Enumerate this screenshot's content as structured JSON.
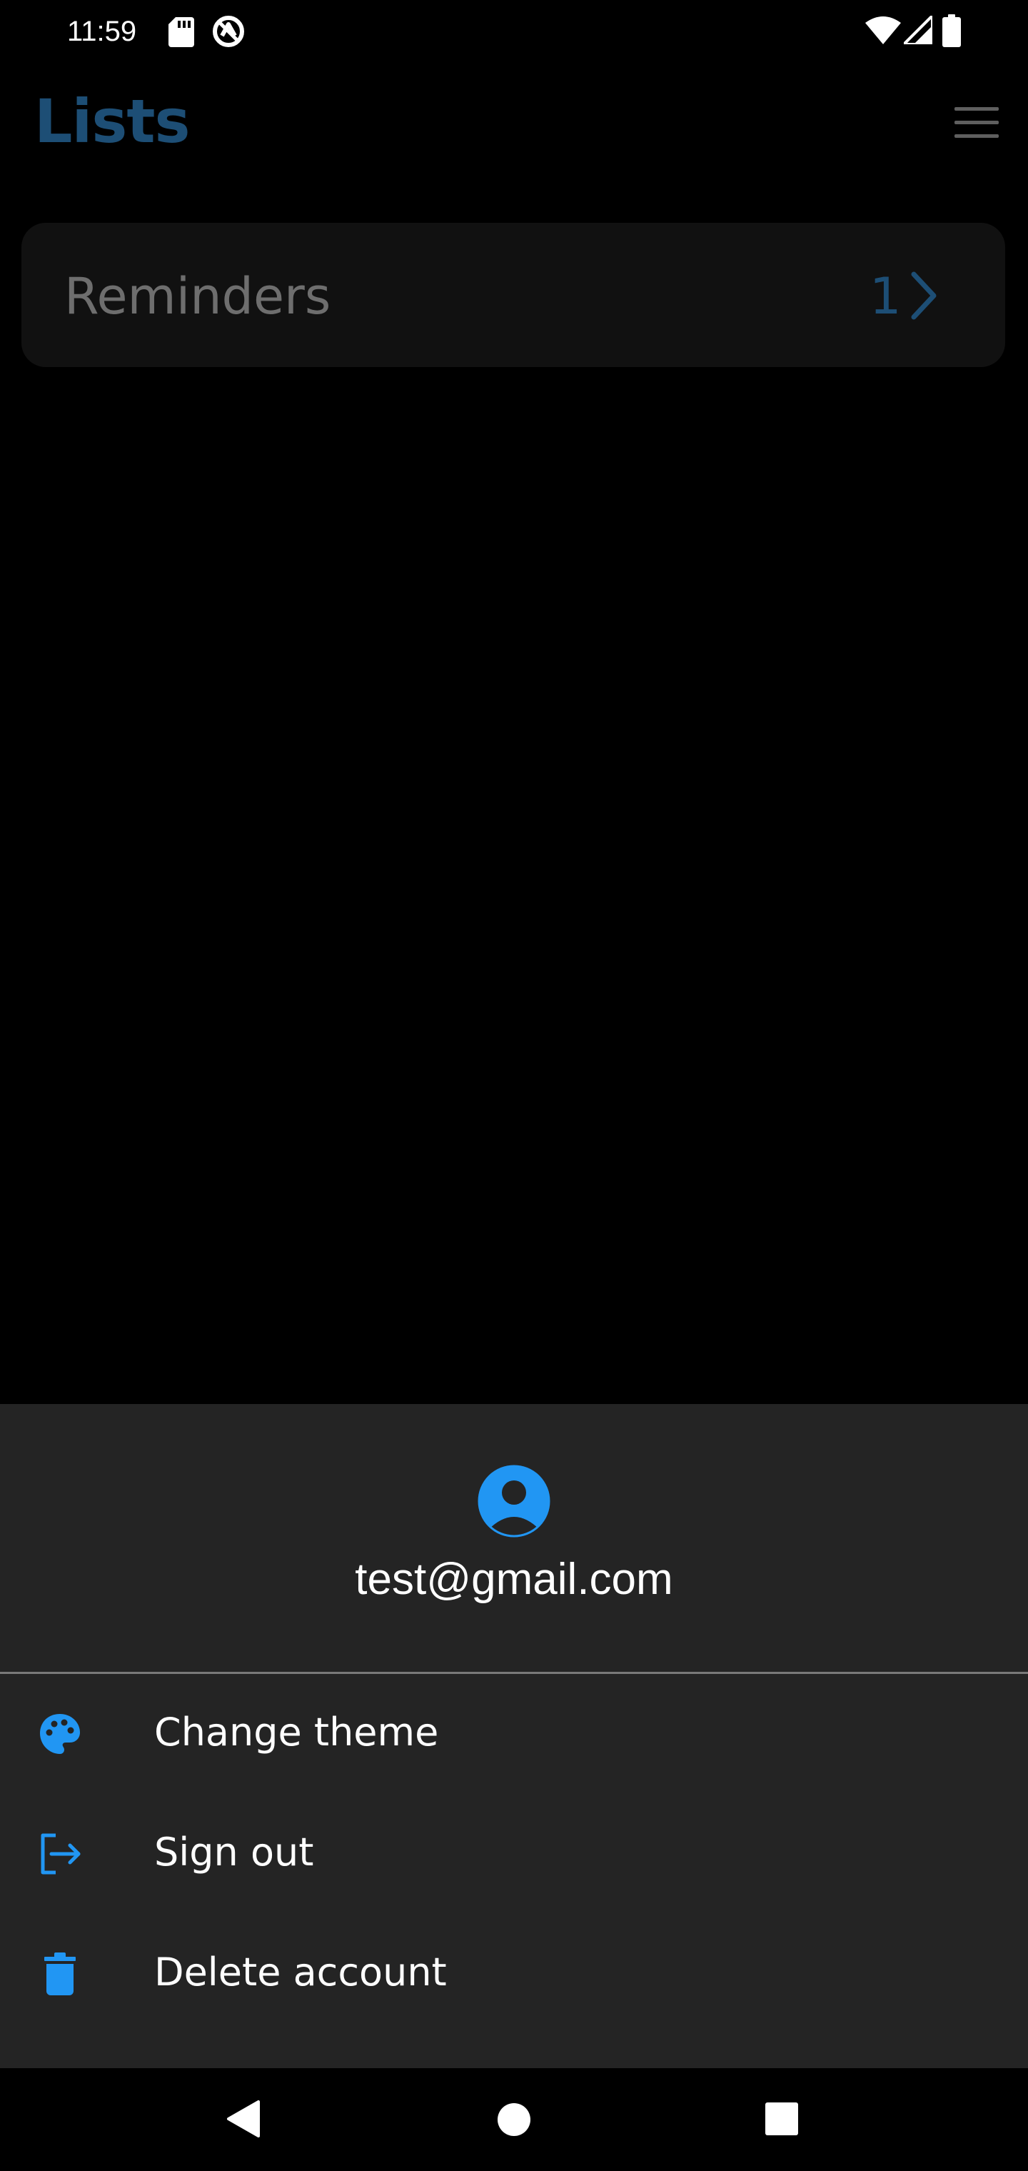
{
  "status_bar": {
    "time": "11:59",
    "icons": [
      "sd-card-icon",
      "vpn-icon",
      "wifi-icon",
      "signal-icon",
      "battery-icon"
    ]
  },
  "header": {
    "title": "Lists",
    "menu_icon": "hamburger-menu-icon"
  },
  "lists": [
    {
      "name": "Reminders",
      "count": "1",
      "chevron_icon": "chevron-right-icon"
    }
  ],
  "account_sheet": {
    "avatar_icon": "account-circle-icon",
    "email": "test@gmail.com",
    "menu_items": [
      {
        "label": "Change theme",
        "icon": "palette-icon"
      },
      {
        "label": "Sign out",
        "icon": "sign-out-icon"
      },
      {
        "label": "Delete account",
        "icon": "trash-icon"
      }
    ]
  },
  "nav_bar": {
    "buttons": [
      "back-triangle-icon",
      "home-circle-icon",
      "recents-square-icon"
    ]
  },
  "colors": {
    "background": "#000000",
    "title_dimmed": "#1d4e75",
    "menu_icon_dimmed": "#5f5f5f",
    "card_background": "#111111",
    "card_text_dimmed": "#6e6e6e",
    "card_accent_dimmed": "#1d4e75",
    "sheet_background": "#242424",
    "divider": "#7a7a7a",
    "accent": "#2196f3",
    "text_primary": "#ffffff"
  }
}
